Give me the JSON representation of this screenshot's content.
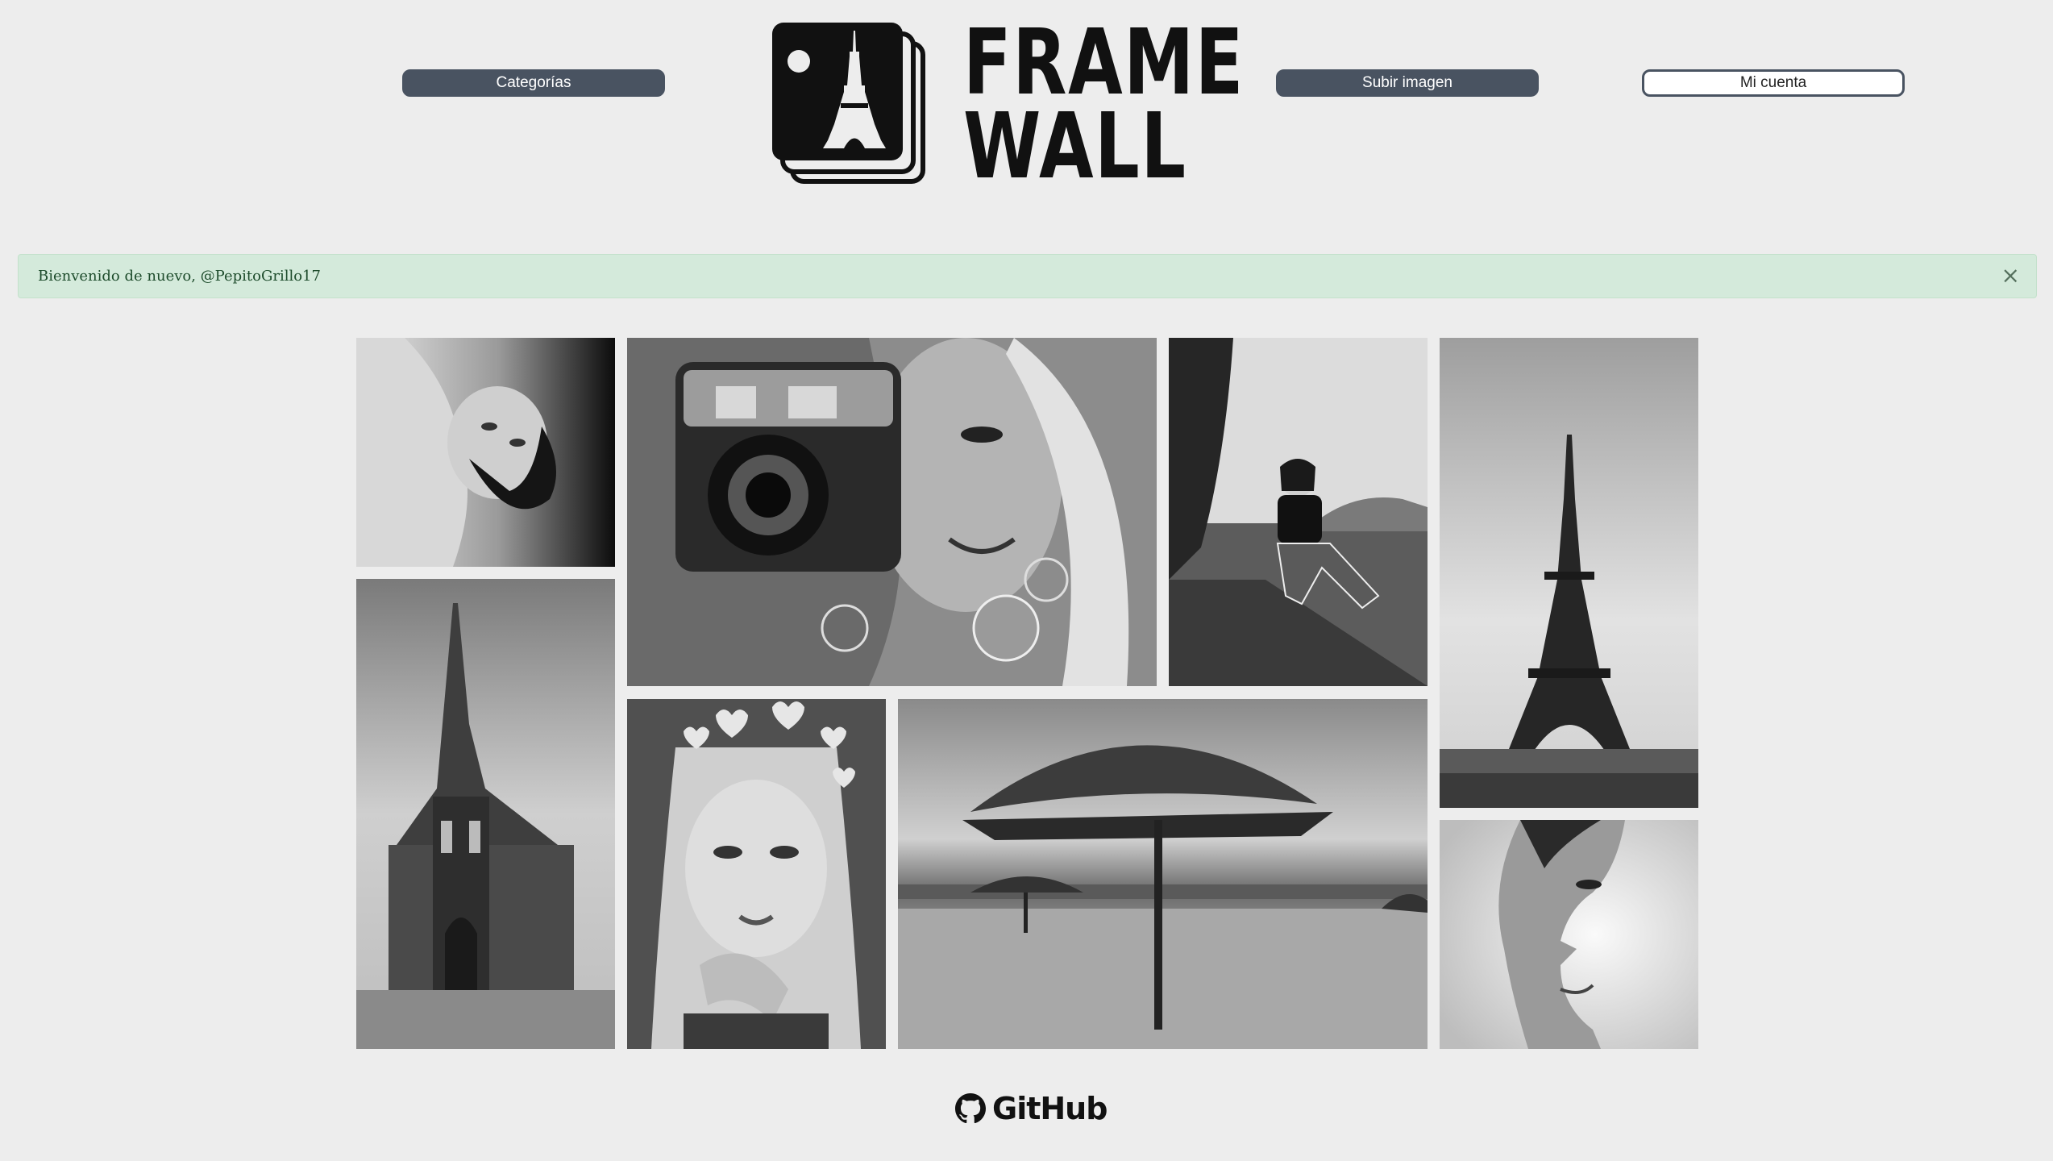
{
  "header": {
    "categories_label": "Categorías",
    "upload_label": "Subir imagen",
    "account_label": "Mi cuenta",
    "logo": {
      "line1": "FRAME",
      "line2": "WALL"
    }
  },
  "alert": {
    "message": "Bienvenido de nuevo, @PepitoGrillo17",
    "close_symbol": "×"
  },
  "gallery": {
    "photos": [
      {
        "name": "photo-woman-lying-portrait"
      },
      {
        "name": "photo-camera-mural"
      },
      {
        "name": "photo-girl-sitting-park"
      },
      {
        "name": "photo-eiffel-tower"
      },
      {
        "name": "photo-gothic-church"
      },
      {
        "name": "photo-girl-hearts-selfie"
      },
      {
        "name": "photo-beach-umbrella"
      },
      {
        "name": "photo-face-illusion"
      }
    ]
  },
  "footer": {
    "github_label": "GitHub",
    "github_icon": "github-icon"
  },
  "colors": {
    "button": "#495361",
    "alert_bg": "#d4eadb",
    "alert_text": "#1e4c2c",
    "page_bg": "#ededed"
  }
}
